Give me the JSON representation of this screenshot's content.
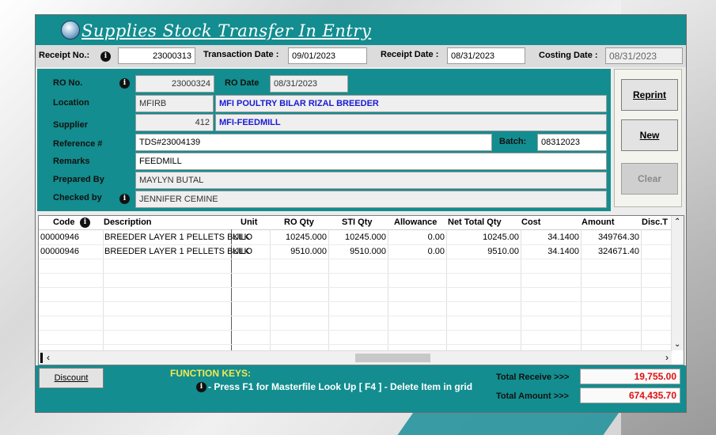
{
  "window": {
    "title": "Supplies Stock Transfer In Entry"
  },
  "header": {
    "receipt_no_label": "Receipt No.:",
    "receipt_no": "23000313",
    "transaction_date_label": "Transaction Date :",
    "transaction_date": "09/01/2023",
    "receipt_date_label": "Receipt Date :",
    "receipt_date": "08/31/2023",
    "costing_date_label": "Costing Date :",
    "costing_date": "08/31/2023"
  },
  "form": {
    "ro_no_label": "RO No.",
    "ro_no": "23000324",
    "ro_date_label": "RO Date",
    "ro_date": "08/31/2023",
    "location_label": "Location",
    "location_code": "MFIRB",
    "location_name": "MFI POULTRY BILAR RIZAL BREEDER",
    "supplier_label": "Supplier",
    "supplier_code": "412",
    "supplier_name": "MFI-FEEDMILL",
    "reference_label": "Reference #",
    "reference": "TDS#23004139",
    "batch_label": "Batch:",
    "batch": "08312023",
    "remarks_label": "Remarks",
    "remarks": "FEEDMILL",
    "prepared_by_label": "Prepared By",
    "prepared_by": "MAYLYN BUTAL",
    "checked_by_label": "Checked by",
    "checked_by": "JENNIFER CEMINE"
  },
  "buttons": {
    "reprint": "Reprint",
    "new": "New",
    "clear": "Clear",
    "discount": "Discount"
  },
  "grid": {
    "columns": [
      "Code",
      "Description",
      "Unit",
      "RO Qty",
      "STI Qty",
      "Allowance",
      "Net Total Qty",
      "Cost",
      "Amount",
      "Disc.T"
    ],
    "rows": [
      [
        "00000946",
        "BREEDER LAYER 1 PELLETS BULK",
        "KILO",
        "10245.000",
        "10245.000",
        "0.00",
        "10245.00",
        "34.1400",
        "349764.30"
      ],
      [
        "00000946",
        "BREEDER LAYER 1 PELLETS BULK",
        "KILO",
        "9510.000",
        "9510.000",
        "0.00",
        "9510.00",
        "34.1400",
        "324671.40"
      ]
    ]
  },
  "footer": {
    "function_keys_title": "FUNCTION KEYS:",
    "function_keys_text": "- Press F1 for Masterfile Look Up  [ F4 ] - Delete Item in grid",
    "total_receive_label": "Total Receive >>>",
    "total_receive": "19,755.00",
    "total_amount_label": "Total Amount >>>",
    "total_amount": "674,435.70"
  },
  "colors": {
    "teal": "#138d8f",
    "total_red": "#e01010",
    "name_blue": "#1a1ad4",
    "function_yellow": "#f3e850"
  }
}
